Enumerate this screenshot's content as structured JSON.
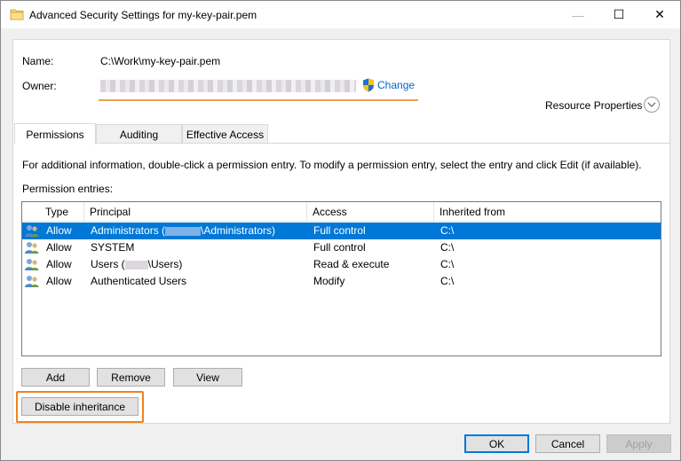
{
  "window": {
    "title": "Advanced Security Settings for my-key-pair.pem",
    "controls": {
      "minimize": "—",
      "maximize": "☐",
      "close": "✕"
    }
  },
  "fields": {
    "name_label": "Name:",
    "name_value": "C:\\Work\\my-key-pair.pem",
    "owner_label": "Owner:",
    "change_link": "Change"
  },
  "resource_properties": "Resource Properties",
  "tabs": [
    {
      "label": "Permissions",
      "active": true
    },
    {
      "label": "Auditing",
      "active": false
    },
    {
      "label": "Effective Access",
      "active": false
    }
  ],
  "info_text": "For additional information, double-click a permission entry. To modify a permission entry, select the entry and click Edit (if available).",
  "entries_label": "Permission entries:",
  "table": {
    "columns": [
      "Type",
      "Principal",
      "Access",
      "Inherited from"
    ],
    "rows": [
      {
        "type": "Allow",
        "principal_prefix": "Administrators (",
        "principal_suffix": "\\Administrators)",
        "access": "Full control",
        "inherited": "C:\\",
        "selected": true
      },
      {
        "type": "Allow",
        "principal": "SYSTEM",
        "access": "Full control",
        "inherited": "C:\\",
        "selected": false
      },
      {
        "type": "Allow",
        "principal_prefix": "Users (",
        "principal_suffix": "\\Users)",
        "access": "Read & execute",
        "inherited": "C:\\",
        "selected": false
      },
      {
        "type": "Allow",
        "principal": "Authenticated Users",
        "access": "Modify",
        "inherited": "C:\\",
        "selected": false
      }
    ]
  },
  "buttons": {
    "add": "Add",
    "remove": "Remove",
    "view": "View",
    "disable_inheritance": "Disable inheritance",
    "ok": "OK",
    "cancel": "Cancel",
    "apply": "Apply"
  },
  "colors": {
    "selection": "#0078d7",
    "link": "#0066cc",
    "highlight": "#f0821e"
  }
}
